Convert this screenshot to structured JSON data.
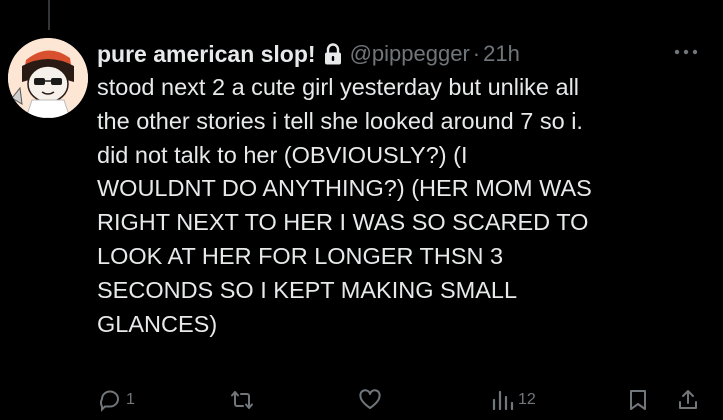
{
  "post": {
    "display_name": "pure american slop!",
    "handle": "@pippegger",
    "separator": "·",
    "time": "21h",
    "body_lines": [
      "stood next 2 a cute girl yesterday but unlike all",
      "the other stories i tell she looked around 7 so i.",
      "did not talk to her (OBVIOUSLY?) (I",
      "WOULDNT DO ANYTHING?) (HER MOM WAS",
      "RIGHT NEXT TO HER I WAS SO SCARED TO",
      "LOOK AT HER FOR LONGER THSN 3",
      "SECONDS SO I KEPT MAKING SMALL",
      "GLANCES)"
    ]
  },
  "actions": {
    "reply_count": "1",
    "repost_count": "",
    "like_count": "",
    "views_count": "12"
  },
  "icons": {
    "lock": "lock-icon",
    "more": "more-icon",
    "reply": "reply-icon",
    "repost": "repost-icon",
    "like": "like-icon",
    "views": "views-icon",
    "bookmark": "bookmark-icon",
    "share": "share-icon"
  },
  "colors": {
    "background": "#000000",
    "text_primary": "#e7e9ea",
    "text_secondary": "#71767b",
    "thread_line": "#333639"
  }
}
